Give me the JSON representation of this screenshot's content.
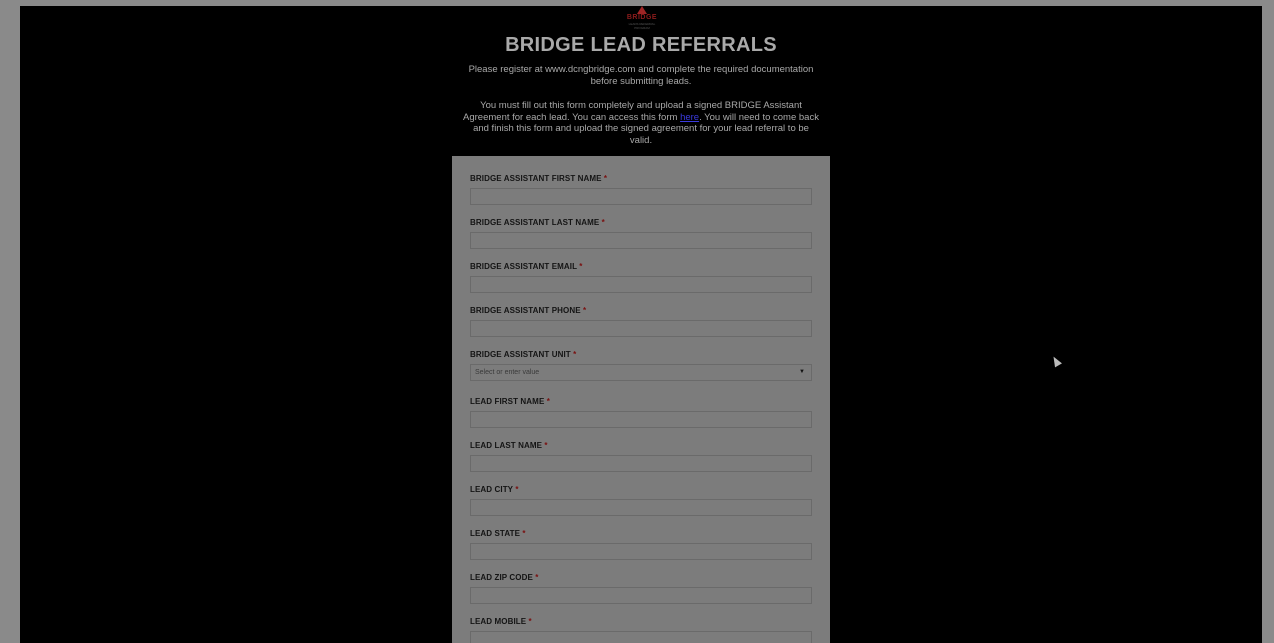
{
  "logo": {
    "brand": "BRIDGE",
    "sub": "LEADS REFERRAL PROGRAM"
  },
  "title": "BRIDGE LEAD REFERRALS",
  "intro": {
    "p1": "Please register at www.dcngbridge.com and complete the required documentation before submitting leads.",
    "p2_before": "You must fill out this form completely and upload a signed BRIDGE Assistant Agreement for each lead. You can access this form ",
    "p2_link": "here",
    "p2_after": ". You will need to come back and finish this form and upload the signed agreement for your lead referral to be valid."
  },
  "form": {
    "required_marker": "*",
    "fields": {
      "assistant_first_name": "BRIDGE ASSISTANT FIRST NAME",
      "assistant_last_name": "BRIDGE ASSISTANT LAST NAME",
      "assistant_email": "BRIDGE ASSISTANT EMAIL",
      "assistant_phone": "BRIDGE ASSISTANT PHONE",
      "assistant_unit": "BRIDGE ASSISTANT UNIT",
      "assistant_unit_placeholder": "Select or enter value",
      "lead_first_name": "LEAD FIRST NAME",
      "lead_last_name": "LEAD LAST NAME",
      "lead_city": "LEAD CITY",
      "lead_state": "LEAD STATE",
      "lead_zip": "LEAD ZIP CODE",
      "lead_mobile": "LEAD MOBILE"
    }
  },
  "colors": {
    "background": "#000000",
    "form_panel": "#7c7c7c",
    "required": "#7a1010",
    "brand_red": "#a02525"
  }
}
